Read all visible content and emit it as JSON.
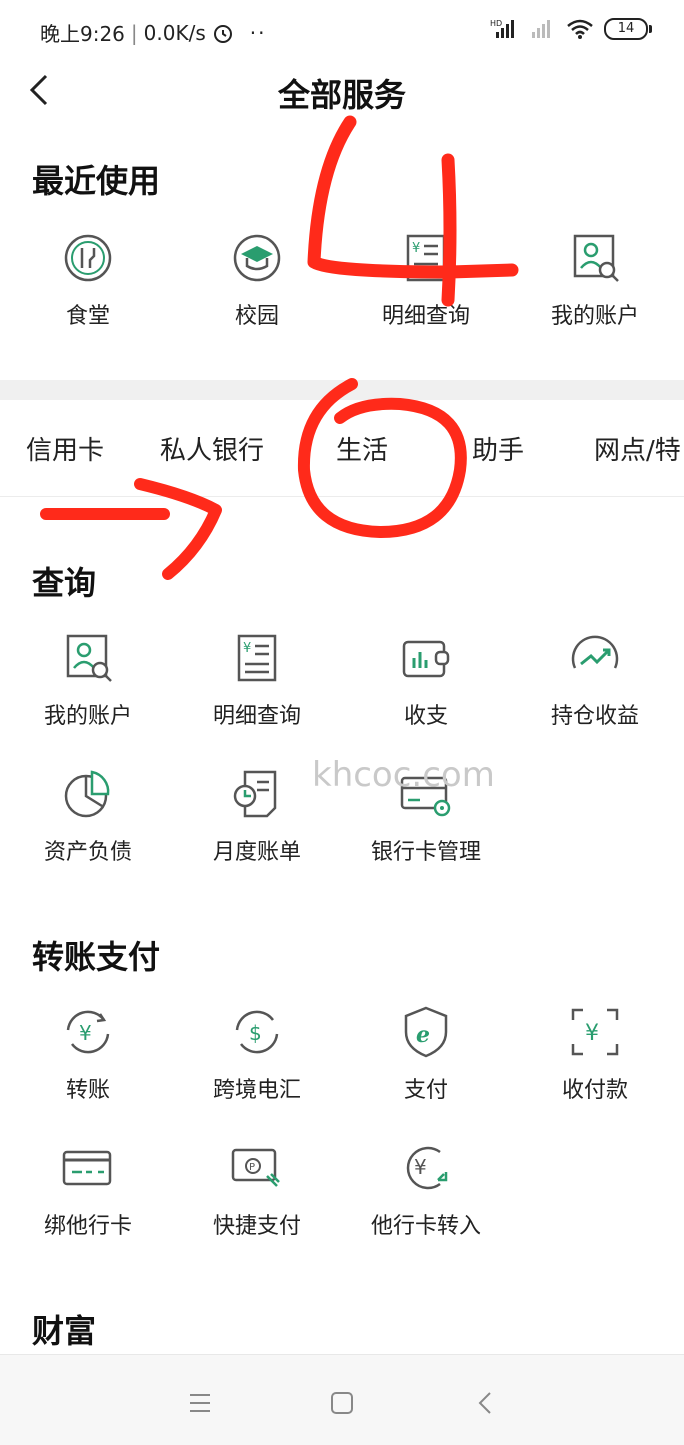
{
  "status": {
    "time": "晚上9:26",
    "speed": "0.0K/s",
    "battery": "14",
    "hd": "HD"
  },
  "header": {
    "title": "全部服务"
  },
  "recent": {
    "title": "最近使用",
    "items": [
      {
        "label": "食堂",
        "icon": "utensils-icon"
      },
      {
        "label": "校园",
        "icon": "graduation-cap-icon"
      },
      {
        "label": "明细查询",
        "icon": "statement-icon"
      },
      {
        "label": "我的账户",
        "icon": "account-search-icon"
      }
    ]
  },
  "tabs": [
    "信用卡",
    "私人银行",
    "生活",
    "助手",
    "网点/特"
  ],
  "query": {
    "title": "查询",
    "items": [
      {
        "label": "我的账户",
        "icon": "account-search-icon"
      },
      {
        "label": "明细查询",
        "icon": "statement-icon"
      },
      {
        "label": "收支",
        "icon": "wallet-chart-icon"
      },
      {
        "label": "持仓收益",
        "icon": "trend-icon"
      },
      {
        "label": "资产负债",
        "icon": "pie-chart-icon"
      },
      {
        "label": "月度账单",
        "icon": "monthly-bill-icon"
      },
      {
        "label": "银行卡管理",
        "icon": "card-gear-icon"
      }
    ]
  },
  "transfer": {
    "title": "转账支付",
    "items": [
      {
        "label": "转账",
        "icon": "transfer-yuan-icon"
      },
      {
        "label": "跨境电汇",
        "icon": "dollar-exchange-icon"
      },
      {
        "label": "支付",
        "icon": "e-pay-shield-icon"
      },
      {
        "label": "收付款",
        "icon": "scan-yuan-icon"
      },
      {
        "label": "绑他行卡",
        "icon": "bind-card-icon"
      },
      {
        "label": "快捷支付",
        "icon": "quick-pay-icon"
      },
      {
        "label": "他行卡转入",
        "icon": "yuan-in-icon"
      }
    ]
  },
  "wealth": {
    "title": "财富"
  },
  "watermark": "khcoc.com",
  "annotations": {
    "number": "4"
  },
  "colors": {
    "accent": "#2a9d6f",
    "icon_gray": "#555555",
    "annotation_red": "#ff2a1a"
  }
}
